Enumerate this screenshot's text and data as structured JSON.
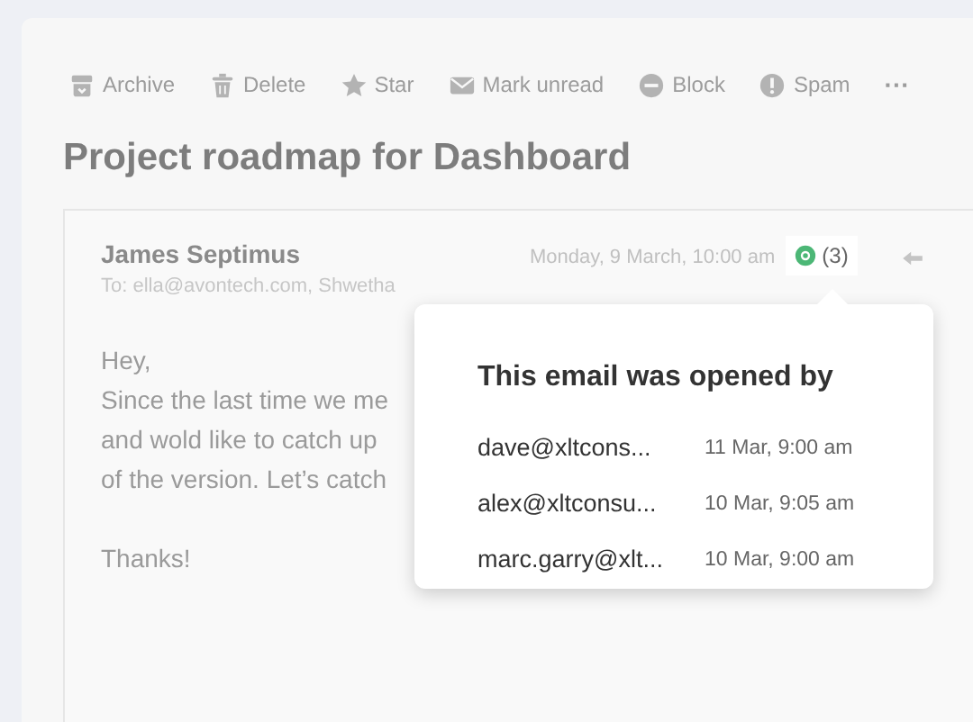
{
  "toolbar": {
    "actions": [
      {
        "label": "Archive"
      },
      {
        "label": "Delete"
      },
      {
        "label": "Star"
      },
      {
        "label": "Mark unread"
      },
      {
        "label": "Block"
      },
      {
        "label": "Spam"
      }
    ],
    "more": "···"
  },
  "subject": "Project roadmap for Dashboard",
  "message": {
    "sender": "James Septimus",
    "recipients": "To: ella@avontech.com, Shwetha",
    "date": "Monday, 9 March, 10:00 am",
    "opens_count": "(3)",
    "body": [
      [
        "Hey,",
        "Since the last time we me",
        "and wold like to catch up",
        "of the version. Let’s catch"
      ],
      [
        "Thanks!"
      ]
    ]
  },
  "popover": {
    "title": "This email was opened by",
    "opens": [
      {
        "email": "dave@xltcons...",
        "time": "11 Mar, 9:00 am"
      },
      {
        "email": "alex@xltconsu...",
        "time": "10 Mar, 9:05 am"
      },
      {
        "email": "marc.garry@xlt...",
        "time": "10 Mar, 9:00 am"
      }
    ]
  }
}
